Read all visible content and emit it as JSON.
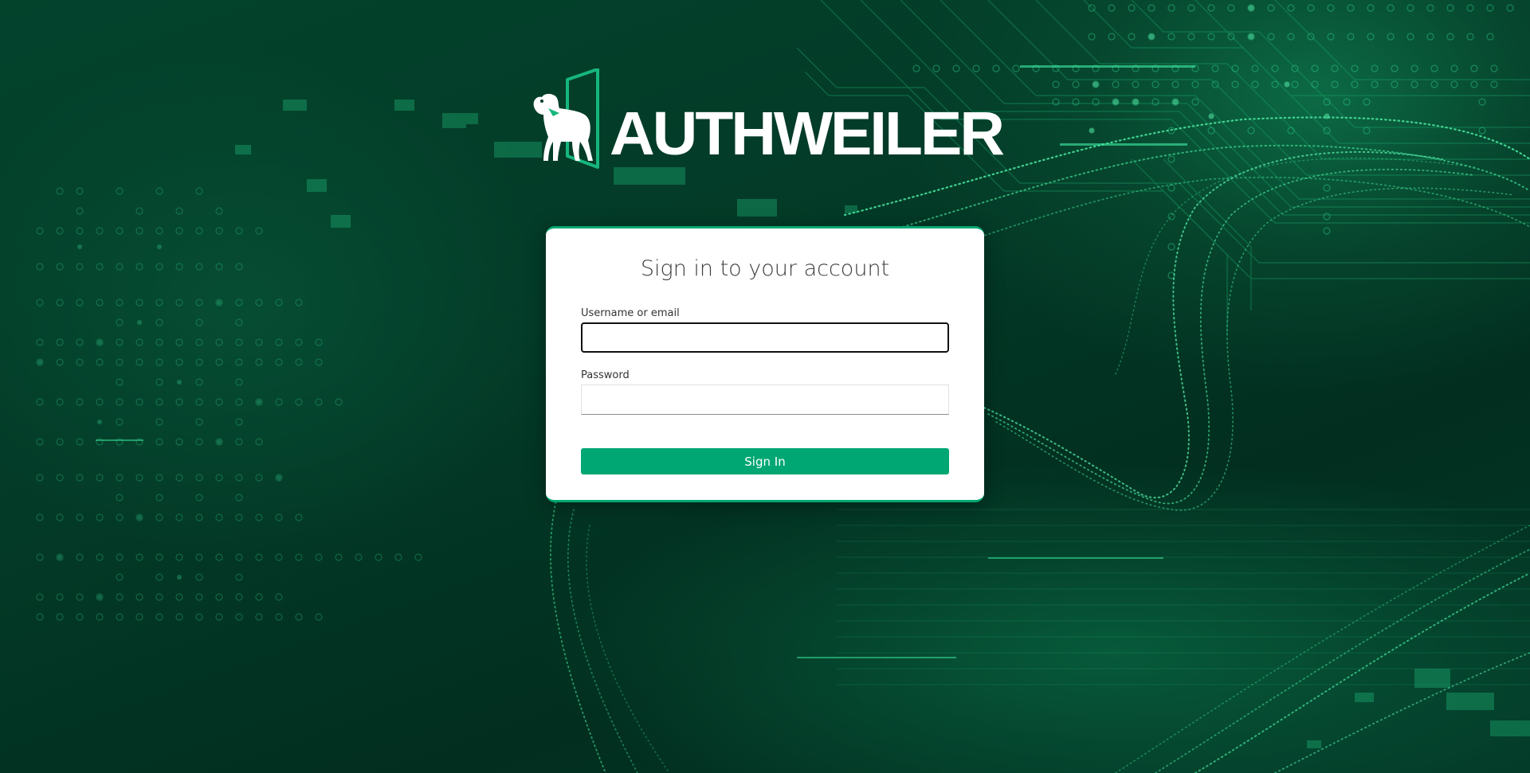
{
  "brand": {
    "name": "AUTHWEILER"
  },
  "login": {
    "title": "Sign in to your account",
    "username_label": "Username or email",
    "username_value": "",
    "password_label": "Password",
    "password_value": "",
    "submit_label": "Sign In"
  },
  "colors": {
    "accent": "#00a773",
    "background": "#033a27",
    "card": "#ffffff"
  },
  "icons": {
    "logo": "dog-in-doorway-keyhole-icon"
  }
}
